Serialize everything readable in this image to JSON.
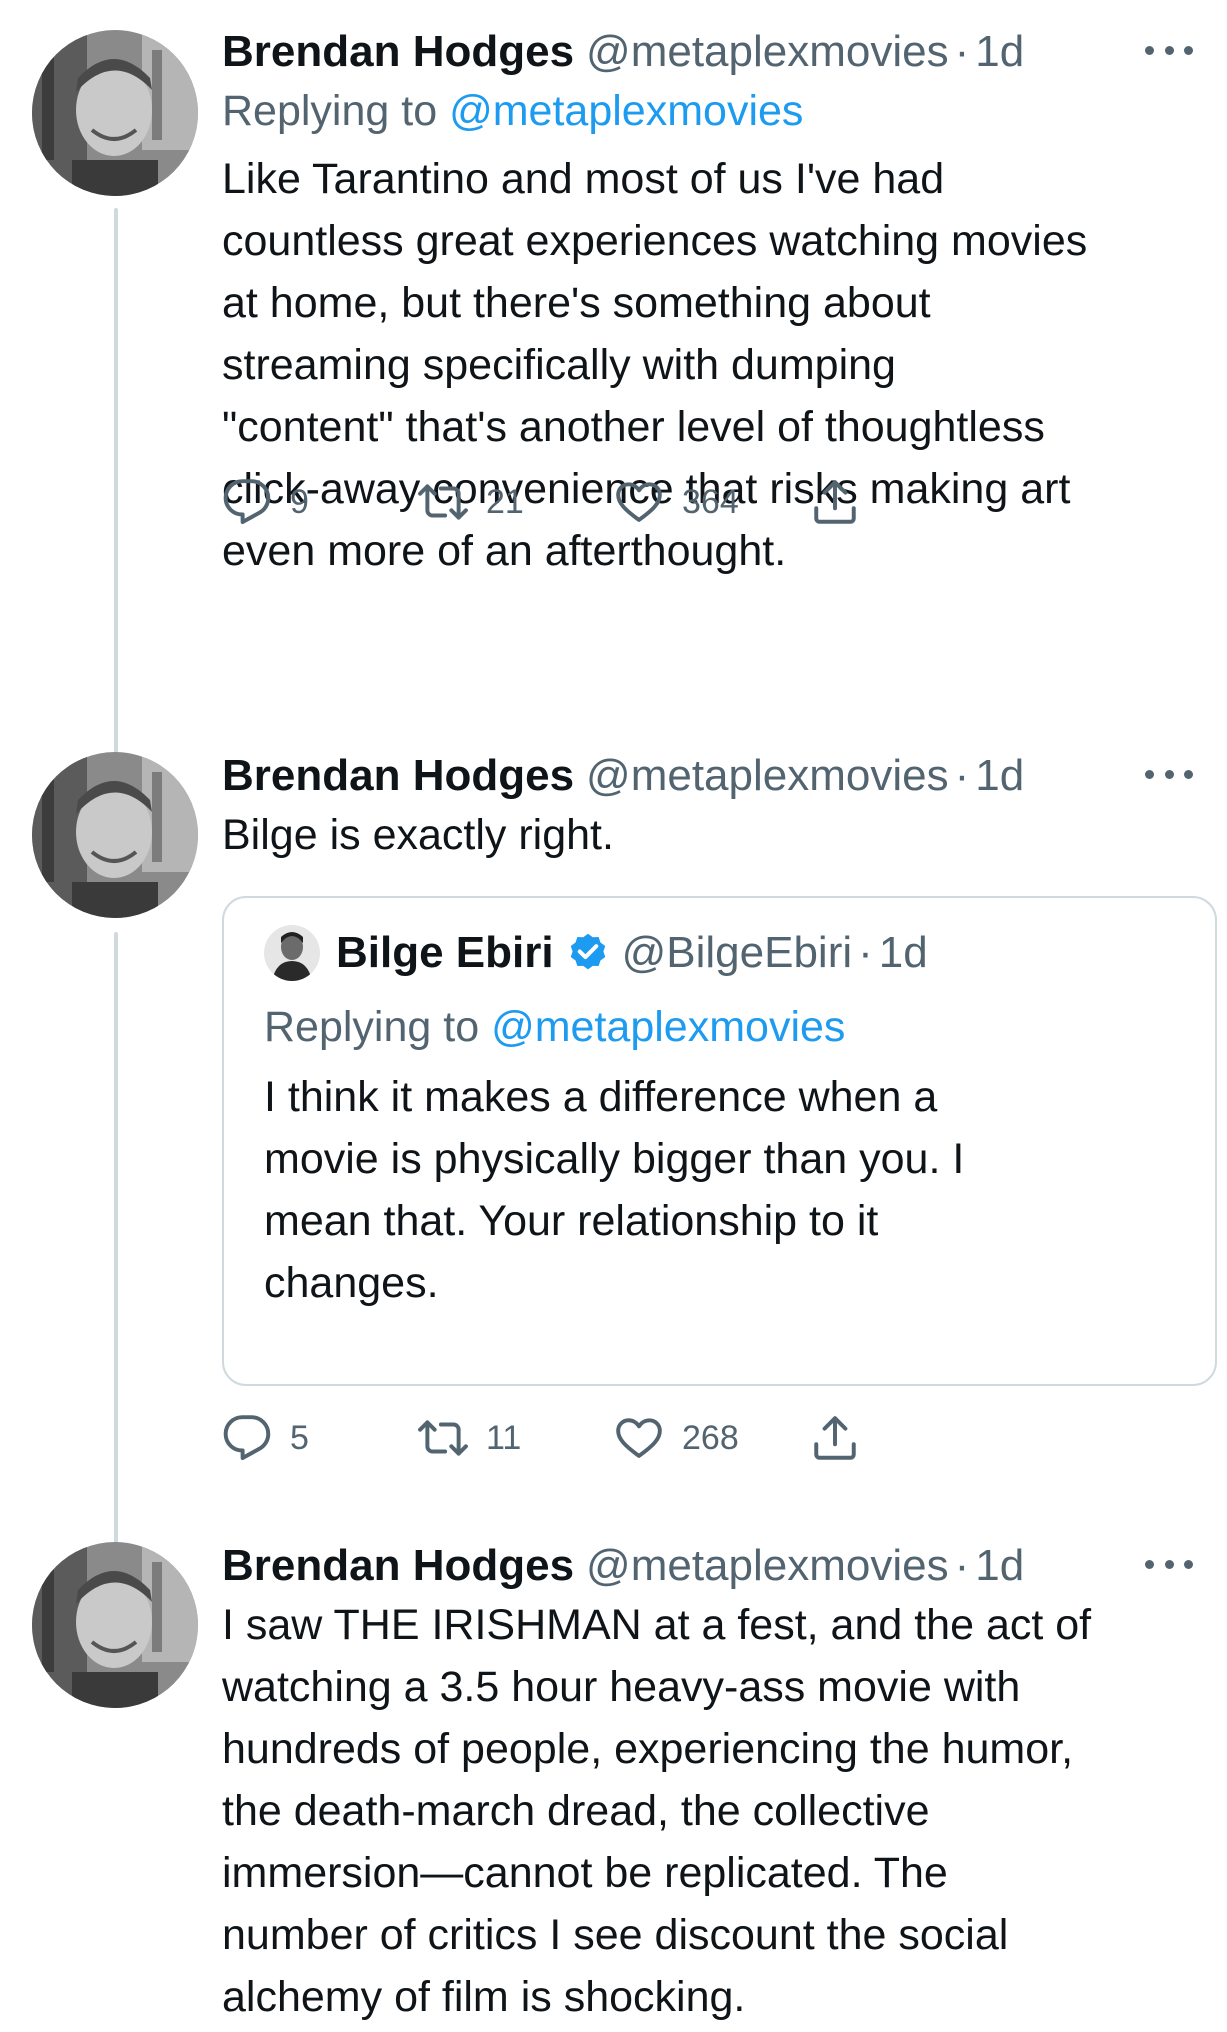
{
  "tweets": [
    {
      "name": "Brendan Hodges",
      "handle": "@metaplexmovies",
      "dot": "·",
      "time": "1d",
      "replying_prefix": "Replying to ",
      "replying_to": "@metaplexmovies",
      "text": "Like Tarantino and most of us I've had\ncountless great experiences watching movies\nat home, but there's something about\nstreaming specifically with dumping\n\"content\" that's another level of thoughtless\nclick-away convenience that risks making art\neven more of an afterthought.",
      "replies": "9",
      "retweets": "21",
      "likes": "364"
    },
    {
      "name": "Brendan Hodges",
      "handle": "@metaplexmovies",
      "dot": "·",
      "time": "1d",
      "text": "Bilge is exactly right.",
      "quote": {
        "name": "Bilge Ebiri",
        "handle": "@BilgeEbiri",
        "dot": "·",
        "time": "1d",
        "replying_prefix": "Replying to ",
        "replying_to": "@metaplexmovies",
        "text": "I think it makes a difference when a\nmovie is physically bigger than you. I\nmean that. Your relationship to it\nchanges."
      },
      "replies": "5",
      "retweets": "11",
      "likes": "268"
    },
    {
      "name": "Brendan Hodges",
      "handle": "@metaplexmovies",
      "dot": "·",
      "time": "1d",
      "text": "I saw THE IRISHMAN at a fest, and the act of\nwatching a 3.5 hour heavy-ass movie with\nhundreds of people, experiencing the humor,\nthe death-march dread, the collective\nimmersion—cannot be replicated. The\nnumber of critics I see discount the social\nalchemy of film is shocking."
    }
  ],
  "icons": {
    "reply": "reply-icon",
    "retweet": "retweet-icon",
    "like": "heart-icon",
    "share": "share-icon",
    "more": "more-icon",
    "verified": "verified-badge-icon"
  },
  "colors": {
    "link": "#1d9bf0",
    "secondary_text": "#536471",
    "thread_line": "#cfd9de",
    "primary_text": "#0f1419"
  }
}
